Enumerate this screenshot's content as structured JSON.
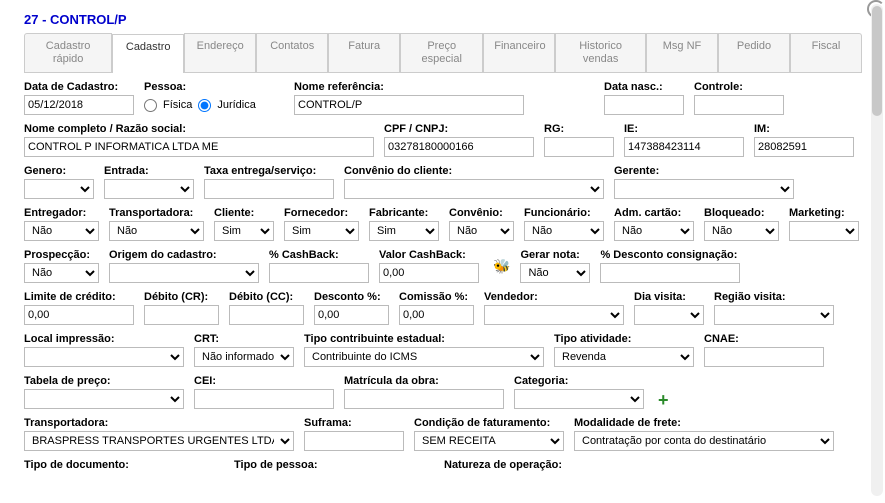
{
  "title": "27 - CONTROL/P",
  "tabs": [
    {
      "label": "Cadastro rápido"
    },
    {
      "label": "Cadastro"
    },
    {
      "label": "Endereço"
    },
    {
      "label": "Contatos"
    },
    {
      "label": "Fatura"
    },
    {
      "label": "Preço especial"
    },
    {
      "label": "Financeiro"
    },
    {
      "label": "Historico vendas"
    },
    {
      "label": "Msg NF"
    },
    {
      "label": "Pedido"
    },
    {
      "label": "Fiscal"
    }
  ],
  "labels": {
    "data_cadastro": "Data de Cadastro:",
    "pessoa": "Pessoa:",
    "fisica": "Física",
    "juridica": "Jurídica",
    "nome_ref": "Nome referência:",
    "data_nasc": "Data nasc.:",
    "controle": "Controle:",
    "nome_completo": "Nome completo / Razão social:",
    "cpf_cnpj": "CPF / CNPJ:",
    "rg": "RG:",
    "ie": "IE:",
    "im": "IM:",
    "genero": "Genero:",
    "entrada": "Entrada:",
    "taxa_entrega": "Taxa entrega/serviço:",
    "convenio_cliente": "Convênio do cliente:",
    "gerente": "Gerente:",
    "entregador": "Entregador:",
    "transportadora": "Transportadora:",
    "cliente": "Cliente:",
    "fornecedor": "Fornecedor:",
    "fabricante": "Fabricante:",
    "convenio": "Convênio:",
    "funcionario": "Funcionário:",
    "adm_cartao": "Adm. cartão:",
    "bloqueado": "Bloqueado:",
    "marketing": "Marketing:",
    "prospeccao": "Prospecção:",
    "origem_cadastro": "Origem do cadastro:",
    "pct_cashback": "% CashBack:",
    "valor_cashback": "Valor CashBack:",
    "gerar_nota": "Gerar nota:",
    "pct_desconto_cons": "% Desconto consignação:",
    "limite_credito": "Limite de crédito:",
    "debito_cr": "Débito (CR):",
    "debito_cc": "Débito (CC):",
    "desconto_pct": "Desconto %:",
    "comissao_pct": "Comissão %:",
    "vendedor": "Vendedor:",
    "dia_visita": "Dia visita:",
    "regiao_visita": "Região visita:",
    "local_impressao": "Local impressão:",
    "crt": "CRT:",
    "tipo_contrib": "Tipo contribuinte estadual:",
    "tipo_atividade": "Tipo atividade:",
    "cnae": "CNAE:",
    "tabela_preco": "Tabela de preço:",
    "cei": "CEI:",
    "matricula_obra": "Matrícula da obra:",
    "categoria": "Categoria:",
    "transportadora2": "Transportadora:",
    "suframa": "Suframa:",
    "condicao_faturamento": "Condição de faturamento:",
    "modalidade_frete": "Modalidade de frete:",
    "tipo_documento": "Tipo de documento:",
    "tipo_pessoa": "Tipo de pessoa:",
    "natureza_operacao": "Natureza de operação:"
  },
  "values": {
    "data_cadastro": "05/12/2018",
    "nome_ref": "CONTROL/P",
    "data_nasc": "",
    "controle": "",
    "nome_completo": "CONTROL P INFORMATICA LTDA ME",
    "cpf_cnpj": "03278180000166",
    "rg": "",
    "ie": "147388423114",
    "im": "28082591",
    "genero": "",
    "entrada": "",
    "taxa_entrega": "",
    "convenio_cliente": "",
    "gerente": "",
    "entregador": "Não",
    "transportadora": "Não",
    "cliente": "Sim",
    "fornecedor": "Sim",
    "fabricante": "Sim",
    "convenio": "Não",
    "funcionario": "Não",
    "adm_cartao": "Não",
    "bloqueado": "Não",
    "marketing": "",
    "prospeccao": "Não",
    "origem_cadastro": "",
    "pct_cashback": "",
    "valor_cashback": "0,00",
    "gerar_nota": "Não",
    "pct_desconto_cons": "",
    "limite_credito": "0,00",
    "debito_cr": "",
    "debito_cc": "",
    "desconto_pct": "0,00",
    "comissao_pct": "0,00",
    "vendedor": "",
    "dia_visita": "",
    "regiao_visita": "",
    "local_impressao": "",
    "crt": "Não informado",
    "tipo_contrib": "Contribuinte do ICMS",
    "tipo_atividade": "Revenda",
    "cnae": "",
    "tabela_preco": "",
    "cei": "",
    "matricula_obra": "",
    "categoria": "",
    "transportadora2": "BRASPRESS TRANSPORTES URGENTES LTDA",
    "suframa": "",
    "condicao_faturamento": "SEM RECEITA",
    "modalidade_frete": "Contratação por conta do destinatário"
  }
}
